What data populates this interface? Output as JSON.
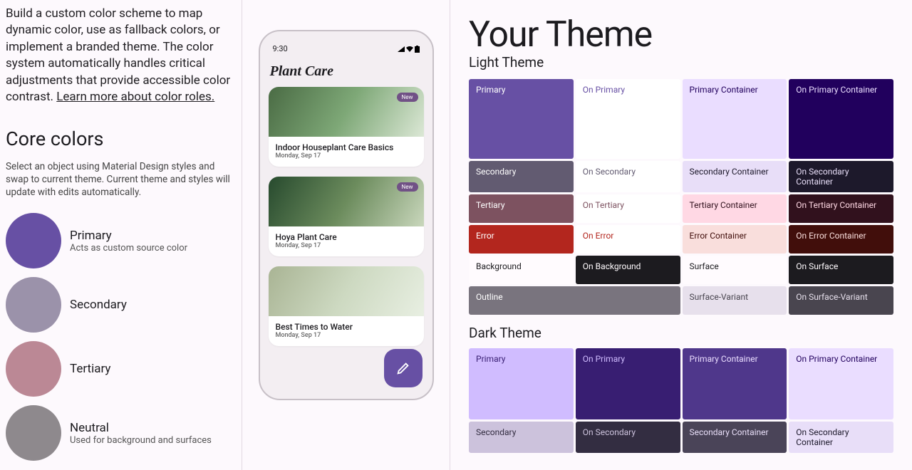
{
  "intro": {
    "body": "Build a custom color scheme to map dynamic color, use as fallback colors, or implement a branded theme. The color system automatically handles critical adjustments that provide accessible color contrast.",
    "link": "Learn more about color roles."
  },
  "core": {
    "title": "Core colors",
    "subtitle": "Select an object using Material Design styles and swap to current theme. Current theme and styles will update with edits automatically.",
    "swatches": [
      {
        "label": "Primary",
        "desc": "Acts as custom source color",
        "hex": "#6750A4"
      },
      {
        "label": "Secondary",
        "desc": "",
        "hex": "#9b92aa"
      },
      {
        "label": "Tertiary",
        "desc": "",
        "hex": "#bb8895"
      },
      {
        "label": "Neutral",
        "desc": "Used for background and surfaces",
        "hex": "#8e898d"
      }
    ]
  },
  "phone": {
    "time": "9:30",
    "app_title": "Plant Care",
    "cards": [
      {
        "badge": "New",
        "title": "Indoor Houseplant Care Basics",
        "date": "Monday, Sep 17"
      },
      {
        "badge": "New",
        "title": "Hoya Plant Care",
        "date": "Monday, Sep 17"
      },
      {
        "badge": "",
        "title": "Best Times to Water",
        "date": "Monday, Sep 17"
      }
    ],
    "fab_icon": "pencil-icon"
  },
  "theme": {
    "title": "Your Theme",
    "light_label": "Light Theme",
    "dark_label": "Dark Theme",
    "light": [
      {
        "label": "Primary",
        "bg": "#6750A4",
        "fg": "#ffffff"
      },
      {
        "label": "On Primary",
        "bg": "#ffffff",
        "fg": "#6750A4"
      },
      {
        "label": "Primary Container",
        "bg": "#EADDFF",
        "fg": "#21005d"
      },
      {
        "label": "On Primary Container",
        "bg": "#21005D",
        "fg": "#EADDFF"
      },
      {
        "label": "Secondary",
        "bg": "#625B71",
        "fg": "#ffffff"
      },
      {
        "label": "On Secondary",
        "bg": "#ffffff",
        "fg": "#625B71"
      },
      {
        "label": "Secondary Container",
        "bg": "#E8DEF8",
        "fg": "#1D192B"
      },
      {
        "label": "On Secondary Container",
        "bg": "#1D192B",
        "fg": "#E8DEF8"
      },
      {
        "label": "Tertiary",
        "bg": "#7D5260",
        "fg": "#ffffff"
      },
      {
        "label": "On Tertiary",
        "bg": "#ffffff",
        "fg": "#7D5260"
      },
      {
        "label": "Tertiary Container",
        "bg": "#FFD8E4",
        "fg": "#31111D"
      },
      {
        "label": "On Tertiary Container",
        "bg": "#31111D",
        "fg": "#FFD8E4"
      },
      {
        "label": "Error",
        "bg": "#B3261E",
        "fg": "#ffffff"
      },
      {
        "label": "On Error",
        "bg": "#ffffff",
        "fg": "#B3261E"
      },
      {
        "label": "Error Container",
        "bg": "#F9DEDC",
        "fg": "#410E0B"
      },
      {
        "label": "On Error Container",
        "bg": "#410E0B",
        "fg": "#F9DEDC"
      },
      {
        "label": "Background",
        "bg": "#FFFBFE",
        "fg": "#1C1B1F"
      },
      {
        "label": "On Background",
        "bg": "#1C1B1F",
        "fg": "#FFFBFE"
      },
      {
        "label": "Surface",
        "bg": "#FFFBFE",
        "fg": "#1C1B1F"
      },
      {
        "label": "On Surface",
        "bg": "#1C1B1F",
        "fg": "#FFFBFE"
      },
      {
        "label": "Outline",
        "bg": "#79747E",
        "fg": "#ffffff"
      },
      {
        "label": "Surface-Variant",
        "bg": "#E7E0EC",
        "fg": "#49454F"
      },
      {
        "label": "On Surface-Variant",
        "bg": "#49454F",
        "fg": "#E7E0EC"
      }
    ],
    "dark": [
      {
        "label": "Primary",
        "bg": "#D0BCFF",
        "fg": "#381E72"
      },
      {
        "label": "On Primary",
        "bg": "#381E72",
        "fg": "#D0BCFF"
      },
      {
        "label": "Primary Container",
        "bg": "#4F378B",
        "fg": "#EADDFF"
      },
      {
        "label": "On Primary Container",
        "bg": "#EADDFF",
        "fg": "#21005D"
      },
      {
        "label": "Secondary",
        "bg": "#CCC2DC",
        "fg": "#332D41"
      },
      {
        "label": "On Secondary",
        "bg": "#332D41",
        "fg": "#CCC2DC"
      },
      {
        "label": "Secondary Container",
        "bg": "#4A4458",
        "fg": "#E8DEF8"
      },
      {
        "label": "On Secondary Container",
        "bg": "#E8DEF8",
        "fg": "#1D192B"
      }
    ]
  }
}
